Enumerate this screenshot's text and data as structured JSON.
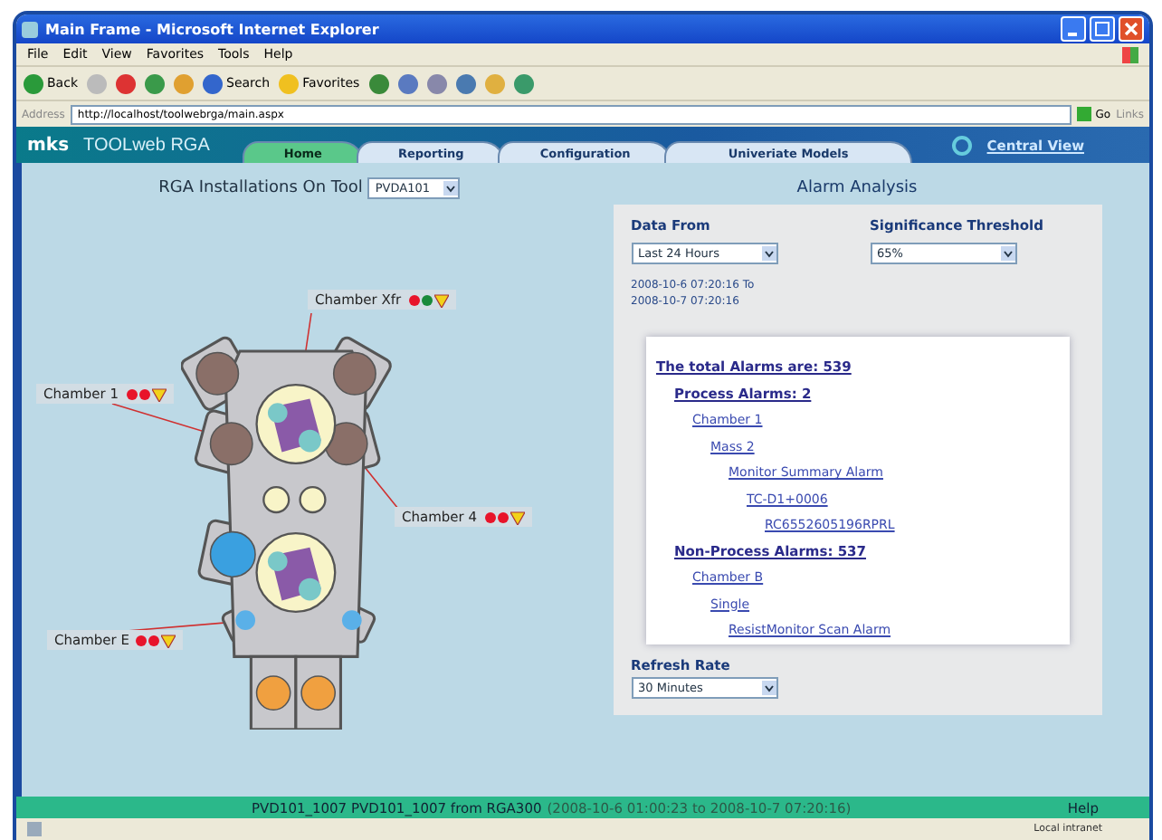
{
  "window": {
    "title": "Main Frame - Microsoft Internet Explorer"
  },
  "menu": [
    "File",
    "Edit",
    "View",
    "Favorites",
    "Tools",
    "Help"
  ],
  "toolbar": [
    {
      "kind": "back",
      "label": "Back"
    },
    {
      "kind": "forward"
    },
    {
      "kind": "stop"
    },
    {
      "kind": "refresh"
    },
    {
      "kind": "home"
    },
    {
      "kind": "search",
      "label": "Search"
    },
    {
      "kind": "favorites",
      "label": "Favorites"
    },
    {
      "kind": "history"
    },
    {
      "kind": "mail"
    },
    {
      "kind": "print"
    },
    {
      "kind": "edit"
    },
    {
      "kind": "folder"
    },
    {
      "kind": "messenger"
    }
  ],
  "address": {
    "label": "Address",
    "value": "http://localhost/toolwebrga/main.aspx",
    "go": "Go",
    "links": "Links"
  },
  "app": {
    "logo": "mks",
    "product": "TOOLweb",
    "product_suffix": "RGA",
    "central_view": "Central View"
  },
  "tabs": [
    {
      "label": "Home",
      "selected": true
    },
    {
      "label": "Reporting",
      "selected": false
    },
    {
      "label": "Configuration",
      "selected": false
    },
    {
      "label": "Univeriate Models",
      "selected": false
    }
  ],
  "installations": {
    "title": "RGA Installations On Tool",
    "tool": "PVDA101",
    "chambers": [
      {
        "name": "Chamber Xfr",
        "indicators": [
          {
            "kind": "dot",
            "color": "#e8142a"
          },
          {
            "kind": "dot",
            "color": "#1a8a3a"
          },
          {
            "kind": "triangle",
            "color": "#f2d21a"
          }
        ]
      },
      {
        "name": "Chamber 1",
        "indicators": [
          {
            "kind": "dot",
            "color": "#e8142a"
          },
          {
            "kind": "dot",
            "color": "#e8142a"
          },
          {
            "kind": "triangle",
            "color": "#f2d21a"
          }
        ]
      },
      {
        "name": "Chamber 4",
        "indicators": [
          {
            "kind": "dot",
            "color": "#e8142a"
          },
          {
            "kind": "dot",
            "color": "#e8142a"
          },
          {
            "kind": "triangle",
            "color": "#f2d21a"
          }
        ]
      },
      {
        "name": "Chamber E",
        "indicators": [
          {
            "kind": "dot",
            "color": "#e8142a"
          },
          {
            "kind": "dot",
            "color": "#e8142a"
          },
          {
            "kind": "triangle",
            "color": "#f2d21a"
          }
        ]
      }
    ]
  },
  "alarm_analysis": {
    "title": "Alarm Analysis",
    "data_from_label": "Data From",
    "data_from": "Last 24 Hours",
    "threshold_label": "Significance Threshold",
    "threshold": "65%",
    "range_from": "2008-10-6 07:20:16 To",
    "range_to": "2008-10-7 07:20:16",
    "tree": [
      {
        "label": "The total Alarms are:  539",
        "children": [
          {
            "label": "Process Alarms:    2",
            "children": [
              {
                "label": "Chamber 1",
                "children": [
                  {
                    "label": "Mass 2",
                    "children": [
                      {
                        "label": "Monitor Summary Alarm",
                        "children": [
                          {
                            "label": "TC-D1+0006",
                            "children": [
                              {
                                "label": "RC6552605196RPRL"
                              }
                            ]
                          }
                        ]
                      }
                    ]
                  }
                ]
              }
            ]
          },
          {
            "label": "Non-Process Alarms:    537",
            "children": [
              {
                "label": "Chamber B",
                "children": [
                  {
                    "label": "Single",
                    "children": [
                      {
                        "label": "ResistMonitor Scan Alarm"
                      }
                    ]
                  }
                ]
              }
            ]
          }
        ]
      }
    ],
    "refresh_label": "Refresh Rate",
    "refresh": "30 Minutes"
  },
  "footer": {
    "text": "PVD101_1007 PVD101_1007 from RGA300",
    "range": "(2008-10-6 01:00:23 to 2008-10-7 07:20:16)",
    "help": "Help"
  },
  "status_bar": {
    "zone": "Local intranet"
  }
}
